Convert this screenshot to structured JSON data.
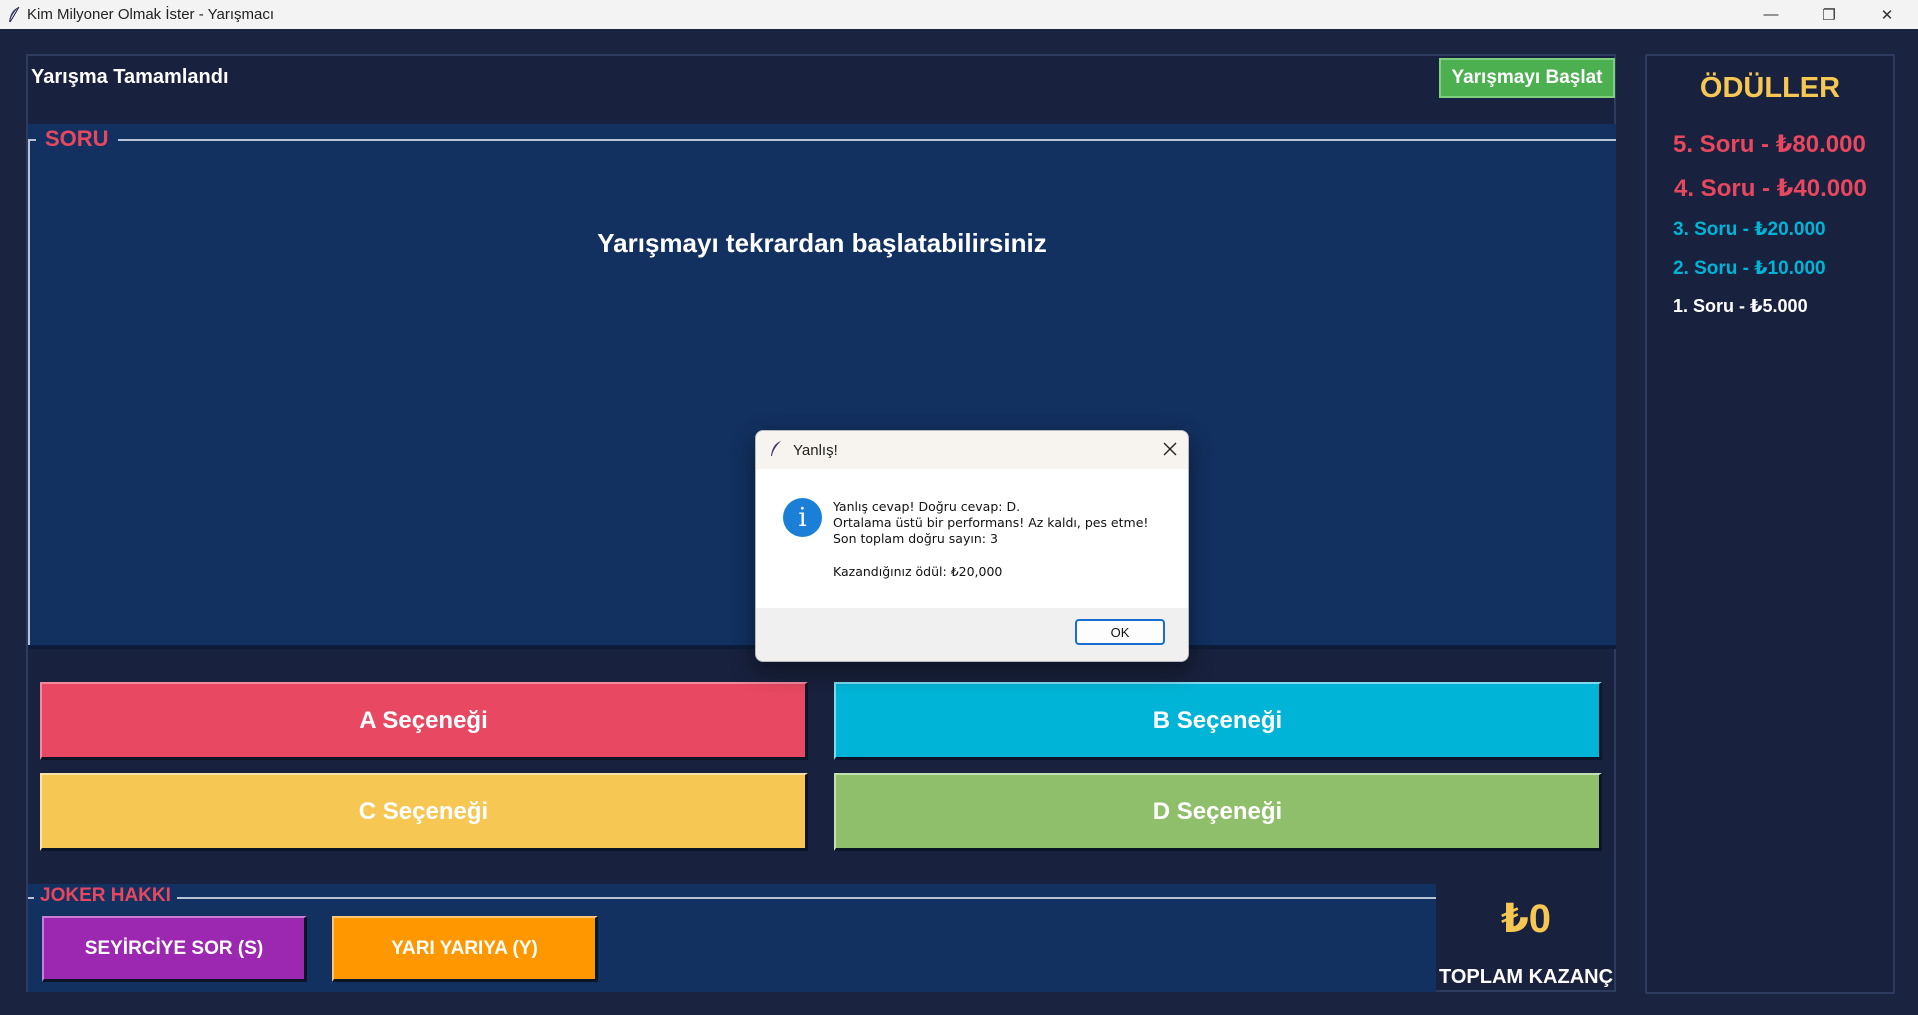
{
  "window": {
    "title": "Kim Milyoner Olmak İster - Yarışmacı",
    "minimize_symbol": "—",
    "restore_symbol": "❐",
    "close_symbol": "✕"
  },
  "header": {
    "status": "Yarışma Tamamlandı",
    "start_button": "Yarışmayı Başlat"
  },
  "question_panel": {
    "legend": "SORU",
    "question": "Yarışmayı tekrardan başlatabilirsiniz"
  },
  "options": {
    "a": "A Seçeneği",
    "b": "B Seçeneği",
    "c": "C Seçeneği",
    "d": "D Seçeneği"
  },
  "joker": {
    "legend": "JOKER HAKKI",
    "audience": "SEYİRCİYE SOR (S)",
    "fifty": "YARI YARIYA (Y)"
  },
  "total": {
    "amount": "₺0",
    "label": "TOPLAM KAZANÇ"
  },
  "awards": {
    "title": "ÖDÜLLER",
    "items": [
      "5. Soru - ₺80.000",
      "4. Soru - ₺40.000",
      "3. Soru - ₺20.000",
      "2. Soru - ₺10.000",
      "1. Soru - ₺5.000"
    ]
  },
  "dialog": {
    "title": "Yanlış!",
    "line1": "Yanlış cevap! Doğru cevap: D.",
    "line2": "Ortalama üstü bir performans! Az kaldı, pes etme!",
    "line3": "Son toplam doğru sayın: 3",
    "line4": "Kazandığınız ödül: ₺20,000",
    "ok": "OK",
    "icon_glyph": "i"
  },
  "colors": {
    "background": "#1a2340",
    "panel": "#123060",
    "accent_red": "#e8485f",
    "accent_blue": "#00b4d8",
    "accent_yellow": "#f6c752",
    "accent_green": "#8fbf6b",
    "start_green": "#4caf50",
    "joker_purple": "#9c27b0",
    "joker_orange": "#ff9800"
  }
}
